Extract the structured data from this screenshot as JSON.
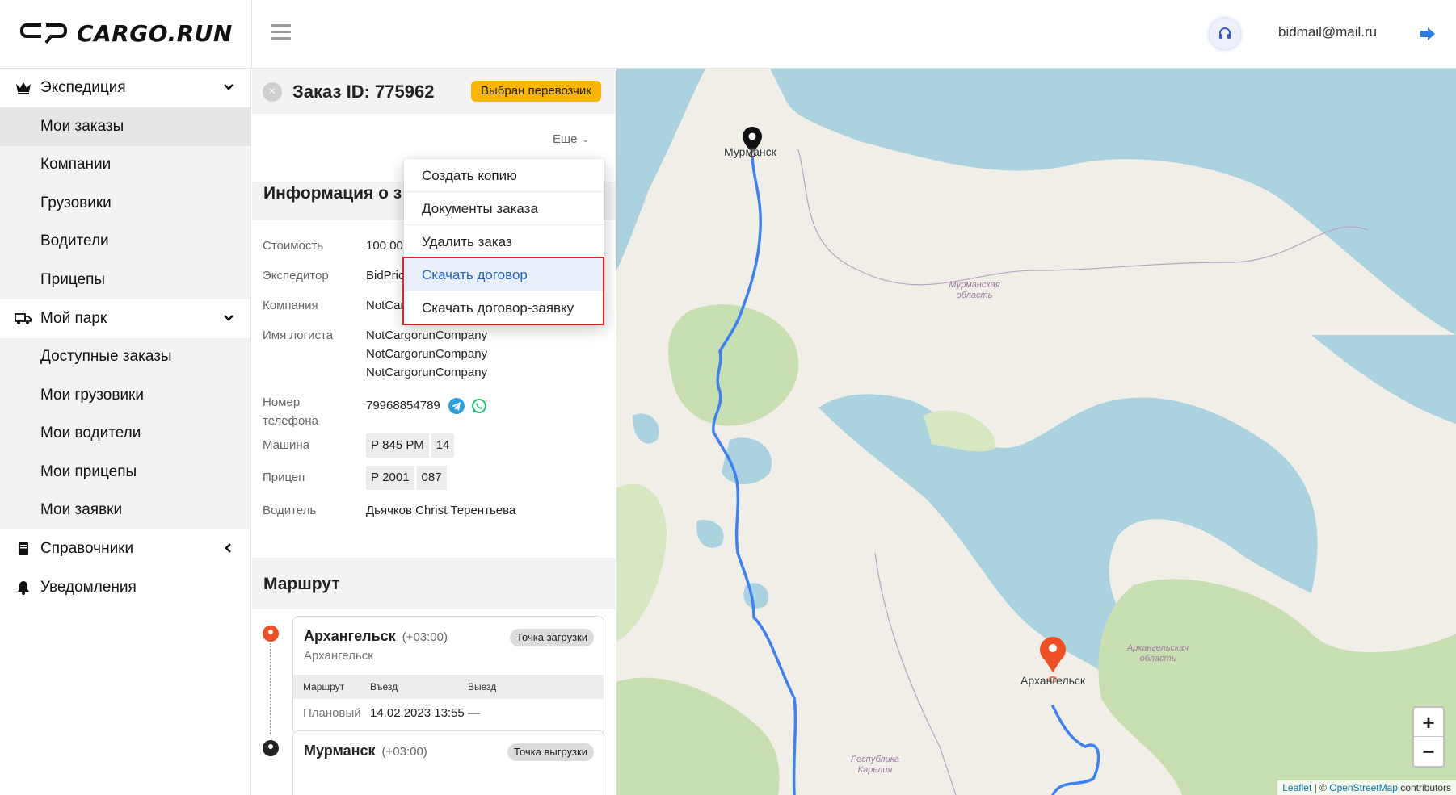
{
  "header": {
    "logo_text": "CARGO.RUN",
    "user_email": "bidmail@mail.ru"
  },
  "sidebar": {
    "groups": [
      {
        "label": "Экспедиция",
        "icon": "crown-icon",
        "expanded": true,
        "items": [
          {
            "label": "Мои заказы",
            "active": true
          },
          {
            "label": "Компании"
          },
          {
            "label": "Грузовики"
          },
          {
            "label": "Водители"
          },
          {
            "label": "Прицепы"
          }
        ]
      },
      {
        "label": "Мой парк",
        "icon": "truck-icon",
        "expanded": true,
        "items": [
          {
            "label": "Доступные заказы"
          },
          {
            "label": "Мои грузовики"
          },
          {
            "label": "Мои водители"
          },
          {
            "label": "Мои прицепы"
          },
          {
            "label": "Мои заявки"
          }
        ]
      },
      {
        "label": "Справочники",
        "icon": "book-icon",
        "expanded": false
      },
      {
        "label": "Уведомления",
        "icon": "bell-icon",
        "expanded": false
      }
    ]
  },
  "order": {
    "title": "Заказ ID: 775962",
    "status": "Выбран перевозчик",
    "more_label": "Еще",
    "info_title": "Информация о з",
    "fields": {
      "cost_label": "Стоимость",
      "cost_value": "100 00",
      "forwarder_label": "Экспедитор",
      "forwarder_value": "BidPric",
      "company_label": "Компания",
      "company_value": "NotCar",
      "logist_label": "Имя логиста",
      "logist_values": [
        "NotCargorunCompany",
        "NotCargorunCompany",
        "NotCargorunCompany"
      ],
      "phone_label_1": "Номер",
      "phone_label_2": "телефона",
      "phone_value": "79968854789",
      "truck_label": "Машина",
      "truck_plate": "Р 845 РМ",
      "truck_region": "14",
      "trailer_label": "Прицеп",
      "trailer_plate": "Р 2001",
      "trailer_region": "087",
      "driver_label": "Водитель",
      "driver_value": "Дьячков Christ Терентьева"
    }
  },
  "dropdown": {
    "items": [
      "Создать копию",
      "Документы заказа",
      "Удалить заказ",
      "Скачать договор",
      "Скачать договор-заявку"
    ],
    "hovered_index": 3
  },
  "route": {
    "title": "Маршрут",
    "points": [
      {
        "city": "Архангельск",
        "tz": "(+03:00)",
        "sub": "Архангельск",
        "type": "Точка загрузки",
        "head": [
          "Маршрут",
          "Въезд",
          "Выезд"
        ],
        "row": [
          "Плановый",
          "14.02.2023 13:55",
          "—"
        ]
      },
      {
        "city": "Мурманск",
        "tz": "(+03:00)",
        "type": "Точка выгрузки"
      }
    ]
  },
  "map": {
    "labels": {
      "murmansk": "Мурманск",
      "arkhangelsk": "Архангельск"
    },
    "regions": {
      "murmansk_obl": "Мурманская область",
      "arkh_obl": "Архангельская область",
      "karelia": "Республика Карелия"
    },
    "zoom_in": "+",
    "zoom_out": "−",
    "attribution_leaflet": "Leaflet",
    "attribution_sep": " | © ",
    "attribution_osm": "OpenStreetMap",
    "attribution_tail": " contributors",
    "colors": {
      "water": "#aad3df",
      "land": "#f1eee8",
      "forest": "#c8dfb1",
      "route": "#3b82f6",
      "dest_pin": "#f04e23"
    }
  }
}
